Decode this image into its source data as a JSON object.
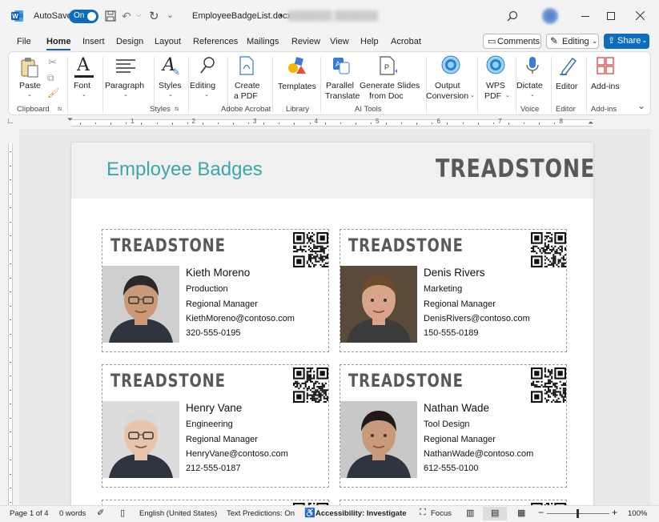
{
  "titlebar": {
    "autosave_label": "AutoSave",
    "toggle_label": "On",
    "filename": "EmployeeBadgeList.docx",
    "filename_suffix": "•",
    "blurred_text": "███████ ███████"
  },
  "menu": {
    "items": [
      "File",
      "Home",
      "Insert",
      "Design",
      "Layout",
      "References",
      "Mailings",
      "Review",
      "View",
      "Help",
      "Acrobat"
    ],
    "active": "Home",
    "comments": "Comments",
    "editing": "Editing",
    "share": "Share"
  },
  "ribbon": {
    "paste": "Paste",
    "font": "Font",
    "paragraph": "Paragraph",
    "styles": "Styles",
    "editing": "Editing",
    "create_pdf": [
      "Create",
      "a PDF"
    ],
    "templates": "Templates",
    "parallel": [
      "Parallel",
      "Translate"
    ],
    "generate": [
      "Generate Slides",
      "from Doc"
    ],
    "output": [
      "Output",
      "Conversion"
    ],
    "wps": [
      "WPS",
      "PDF"
    ],
    "dictate": "Dictate",
    "editor": "Editor",
    "addins": "Add-ins",
    "groups": {
      "clipboard": "Clipboard",
      "styles": "Styles",
      "adobe": "Adobe Acrobat",
      "library": "Library",
      "ai": "AI Tools",
      "voice": "Voice",
      "editor": "Editor",
      "addins": "Add-ins"
    }
  },
  "ruler": {
    "marks": [
      "1",
      "2",
      "3",
      "4",
      "5",
      "6",
      "7",
      "8"
    ]
  },
  "document": {
    "title": "Employee Badges",
    "logo": "TREADSTONE",
    "badges": [
      {
        "name": "Kieth Moreno",
        "dept": "Production",
        "role": "Regional Manager",
        "email": "KiethMoreno@contoso.com",
        "phone": "320-555-0195"
      },
      {
        "name": "Denis Rivers",
        "dept": "Marketing",
        "role": "Regional Manager",
        "email": "DenisRivers@contoso.com",
        "phone": "150-555-0189"
      },
      {
        "name": "Henry Vane",
        "dept": "Engineering",
        "role": "Regional Manager",
        "email": "HenryVane@contoso.com",
        "phone": "212-555-0187"
      },
      {
        "name": "Nathan Wade",
        "dept": "Tool Design",
        "role": "Regional Manager",
        "email": "NathanWade@contoso.com",
        "phone": "612-555-0100"
      }
    ]
  },
  "status": {
    "page": "Page 1 of 4",
    "words": "0 words",
    "language": "English (United States)",
    "predictions": "Text Predictions: On",
    "accessibility": "Accessibility: Investigate",
    "focus": "Focus",
    "zoom": "100%"
  },
  "colors": {
    "accent": "#3ea6a8",
    "word_blue": "#185abd",
    "toggle": "#0f6cbd"
  }
}
